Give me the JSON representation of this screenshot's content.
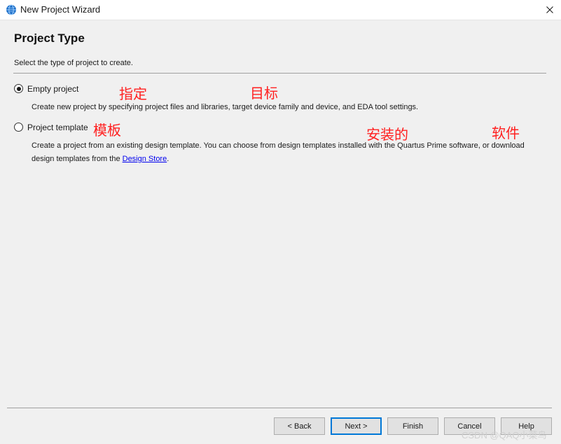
{
  "window": {
    "title": "New Project Wizard",
    "close_glyph": "✕"
  },
  "page": {
    "heading": "Project Type",
    "subtitle": "Select the type of project to create."
  },
  "options": [
    {
      "label": "Empty project",
      "selected": true,
      "description": "Create new project by specifying project files and libraries, target device family and device, and EDA tool settings."
    },
    {
      "label": "Project template",
      "selected": false,
      "description_before_link": "Create a project from an existing design template. You can choose from design templates installed with the Quartus Prime software, or download design templates from the ",
      "link_text": "Design Store",
      "description_after_link": "."
    }
  ],
  "annotations": {
    "zhiding": "指定",
    "mubiao": "目标",
    "muban": "模板",
    "anzhuangde": "安装的",
    "ruanjian": "软件",
    "color": "#ff2020"
  },
  "buttons": {
    "back": "< Back",
    "next": "Next >",
    "finish": "Finish",
    "cancel": "Cancel",
    "help": "Help"
  },
  "watermark": "CSDN @QAQ小菜鸟",
  "colors": {
    "dialog_bg": "#f0f0f0",
    "accent": "#0078d7",
    "link": "#0000ee"
  },
  "icons": {
    "app": "quartus-globe-icon",
    "close": "close-icon"
  }
}
